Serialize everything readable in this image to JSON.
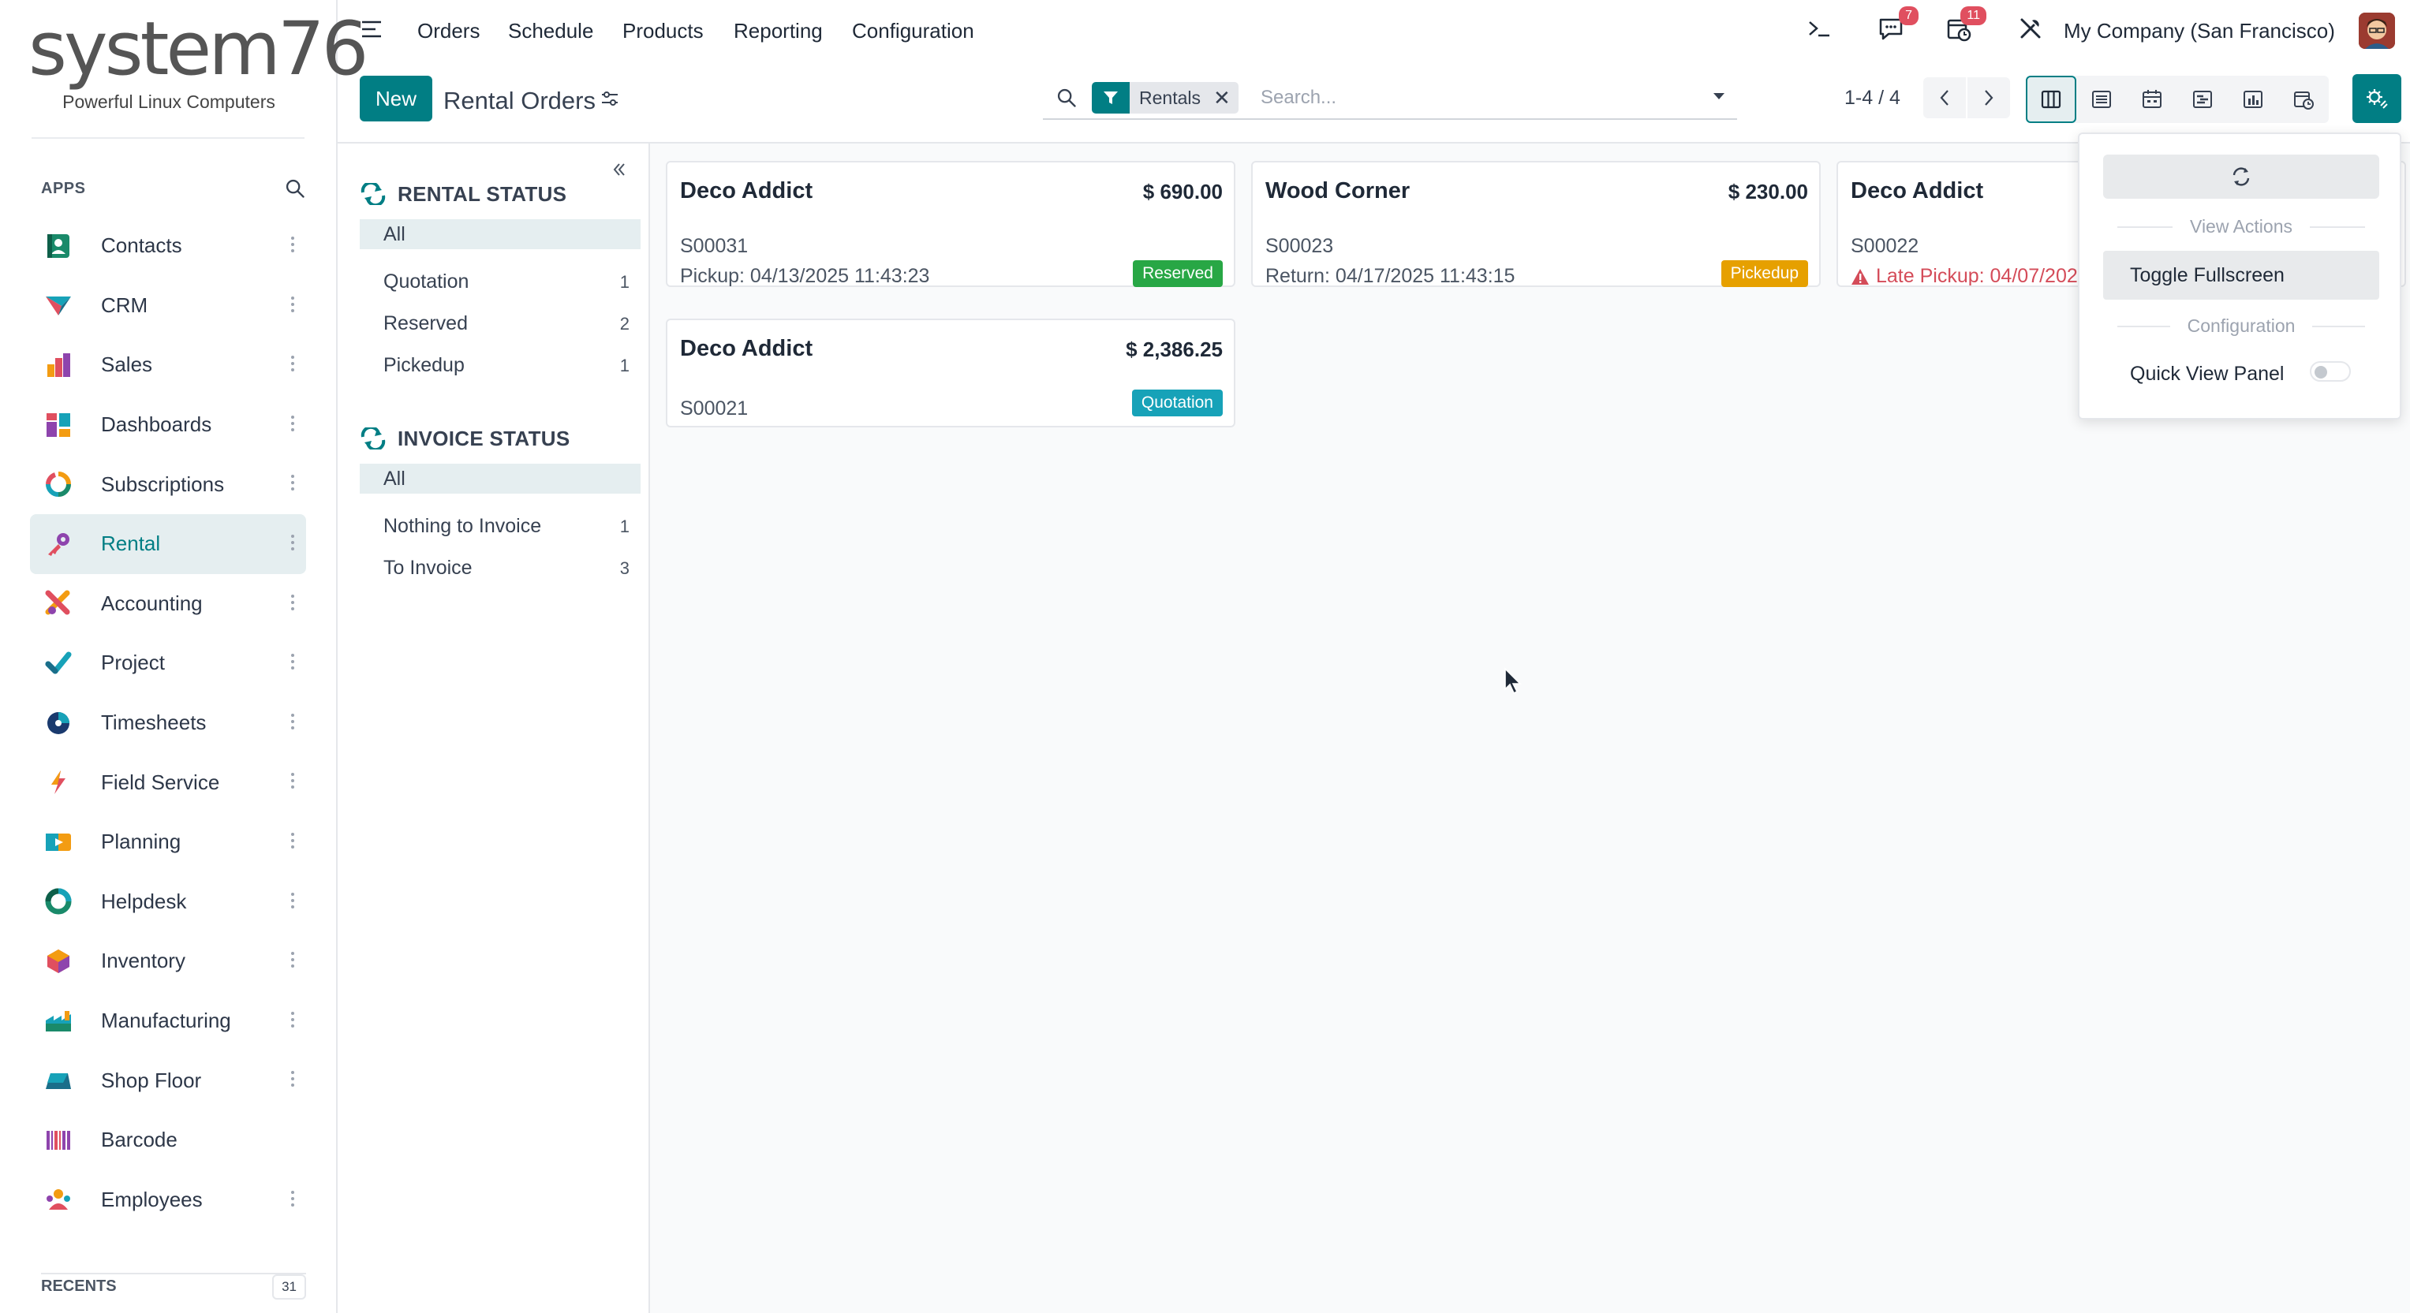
{
  "brand": {
    "logo_text": "system76",
    "tagline": "Powerful Linux Computers"
  },
  "sidebar": {
    "apps_title": "APPS",
    "items": [
      {
        "label": "Contacts",
        "icon": "contacts-icon"
      },
      {
        "label": "CRM",
        "icon": "crm-icon"
      },
      {
        "label": "Sales",
        "icon": "sales-icon"
      },
      {
        "label": "Dashboards",
        "icon": "dashboards-icon"
      },
      {
        "label": "Subscriptions",
        "icon": "subscriptions-icon"
      },
      {
        "label": "Rental",
        "icon": "rental-icon",
        "active": true
      },
      {
        "label": "Accounting",
        "icon": "accounting-icon"
      },
      {
        "label": "Project",
        "icon": "project-icon"
      },
      {
        "label": "Timesheets",
        "icon": "timesheets-icon"
      },
      {
        "label": "Field Service",
        "icon": "field-service-icon"
      },
      {
        "label": "Planning",
        "icon": "planning-icon"
      },
      {
        "label": "Helpdesk",
        "icon": "helpdesk-icon"
      },
      {
        "label": "Inventory",
        "icon": "inventory-icon"
      },
      {
        "label": "Manufacturing",
        "icon": "manufacturing-icon"
      },
      {
        "label": "Shop Floor",
        "icon": "shop-floor-icon"
      },
      {
        "label": "Barcode",
        "icon": "barcode-icon"
      },
      {
        "label": "Employees",
        "icon": "employees-icon"
      }
    ],
    "recents_label": "RECENTS",
    "recents_count": "31"
  },
  "topnav": {
    "menu": [
      "Orders",
      "Schedule",
      "Products",
      "Reporting",
      "Configuration"
    ],
    "messages_badge": "7",
    "activities_badge": "11",
    "company": "My Company (San Francisco)"
  },
  "control_panel": {
    "new_label": "New",
    "title": "Rental Orders",
    "facet_value": "Rentals",
    "search_placeholder": "Search...",
    "pager": "1-4 / 4"
  },
  "search_panel": {
    "rental_status": {
      "title": "RENTAL STATUS",
      "items": [
        {
          "label": "All",
          "count": ""
        },
        {
          "label": "Quotation",
          "count": "1"
        },
        {
          "label": "Reserved",
          "count": "2"
        },
        {
          "label": "Pickedup",
          "count": "1"
        }
      ]
    },
    "invoice_status": {
      "title": "INVOICE STATUS",
      "items": [
        {
          "label": "All",
          "count": ""
        },
        {
          "label": "Nothing to Invoice",
          "count": "1"
        },
        {
          "label": "To Invoice",
          "count": "3"
        }
      ]
    }
  },
  "cards": [
    {
      "partner": "Deco Addict",
      "price": "$ 690.00",
      "ref": "S00031",
      "date": "Pickup: 04/13/2025 11:43:23",
      "badge": "Reserved",
      "badge_color": "#28a745"
    },
    {
      "partner": "Wood Corner",
      "price": "$ 230.00",
      "ref": "S00023",
      "date": "Return: 04/17/2025 11:43:15",
      "badge": "Pickedup",
      "badge_color": "#e6a000"
    },
    {
      "partner": "Deco Addict",
      "price": "",
      "ref": "S00022",
      "date": "Late Pickup: 04/07/202",
      "badge": "",
      "badge_color": ""
    },
    {
      "partner": "Deco Addict",
      "price": "$ 2,386.25",
      "ref": "S00021",
      "date": "",
      "badge": "Quotation",
      "badge_color": "#17a2b8"
    }
  ],
  "dropdown": {
    "view_actions_label": "View Actions",
    "toggle_fullscreen_label": "Toggle Fullscreen",
    "configuration_label": "Configuration",
    "quick_view_panel_label": "Quick View Panel",
    "quick_view_panel_on": false
  },
  "colors": {
    "accent": "#017e84",
    "badge_red": "#e04f5f",
    "late": "#d44c59"
  }
}
